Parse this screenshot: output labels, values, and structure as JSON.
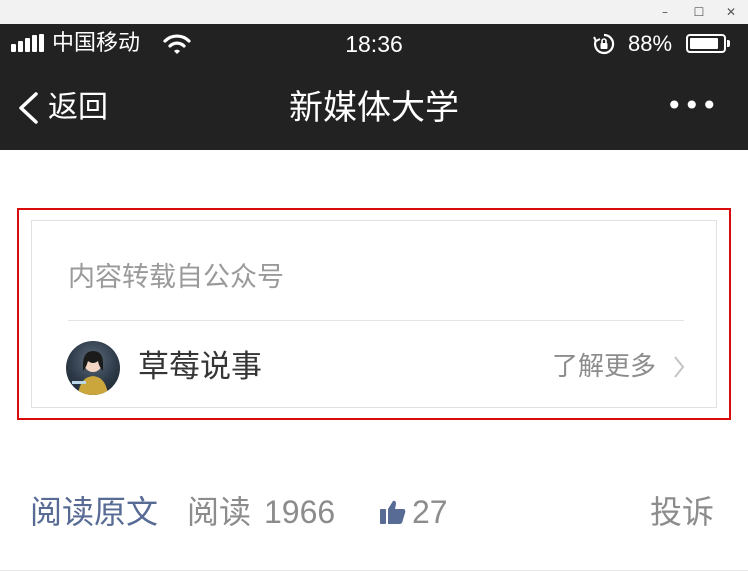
{
  "window": {
    "minimize_glyph": "–",
    "maximize_glyph": "☐",
    "close_glyph": "✕"
  },
  "status_bar": {
    "carrier": "中国移动",
    "time": "18:36",
    "battery_pct": "88%",
    "battery_level": 0.88
  },
  "navbar": {
    "back_label": "返回",
    "title": "新媒体大学",
    "more_label": "•••"
  },
  "reprint_card": {
    "header": "内容转载自公众号",
    "account_name": "草莓说事",
    "learn_more": "了解更多"
  },
  "footer": {
    "read_original": "阅读原文",
    "reads_label": "阅读",
    "reads_count": "1966",
    "likes_count": "27",
    "complain": "投诉"
  },
  "colors": {
    "bar_bg": "#222222",
    "link_blue": "#576b95",
    "highlight_red": "#d80c0c"
  }
}
